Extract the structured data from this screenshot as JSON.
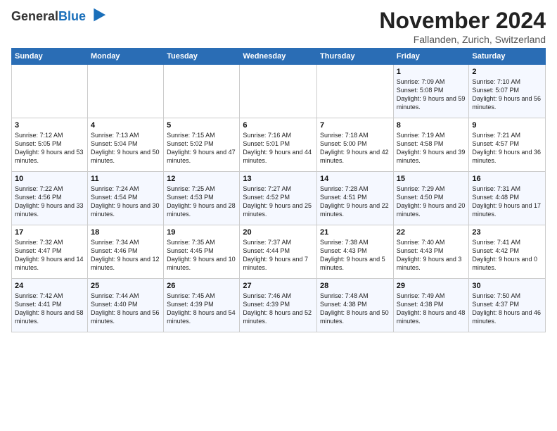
{
  "logo": {
    "text1": "General",
    "text2": "Blue"
  },
  "title": "November 2024",
  "subtitle": "Fallanden, Zurich, Switzerland",
  "days_of_week": [
    "Sunday",
    "Monday",
    "Tuesday",
    "Wednesday",
    "Thursday",
    "Friday",
    "Saturday"
  ],
  "weeks": [
    [
      {
        "day": "",
        "content": ""
      },
      {
        "day": "",
        "content": ""
      },
      {
        "day": "",
        "content": ""
      },
      {
        "day": "",
        "content": ""
      },
      {
        "day": "",
        "content": ""
      },
      {
        "day": "1",
        "content": "Sunrise: 7:09 AM\nSunset: 5:08 PM\nDaylight: 9 hours and 59 minutes."
      },
      {
        "day": "2",
        "content": "Sunrise: 7:10 AM\nSunset: 5:07 PM\nDaylight: 9 hours and 56 minutes."
      }
    ],
    [
      {
        "day": "3",
        "content": "Sunrise: 7:12 AM\nSunset: 5:05 PM\nDaylight: 9 hours and 53 minutes."
      },
      {
        "day": "4",
        "content": "Sunrise: 7:13 AM\nSunset: 5:04 PM\nDaylight: 9 hours and 50 minutes."
      },
      {
        "day": "5",
        "content": "Sunrise: 7:15 AM\nSunset: 5:02 PM\nDaylight: 9 hours and 47 minutes."
      },
      {
        "day": "6",
        "content": "Sunrise: 7:16 AM\nSunset: 5:01 PM\nDaylight: 9 hours and 44 minutes."
      },
      {
        "day": "7",
        "content": "Sunrise: 7:18 AM\nSunset: 5:00 PM\nDaylight: 9 hours and 42 minutes."
      },
      {
        "day": "8",
        "content": "Sunrise: 7:19 AM\nSunset: 4:58 PM\nDaylight: 9 hours and 39 minutes."
      },
      {
        "day": "9",
        "content": "Sunrise: 7:21 AM\nSunset: 4:57 PM\nDaylight: 9 hours and 36 minutes."
      }
    ],
    [
      {
        "day": "10",
        "content": "Sunrise: 7:22 AM\nSunset: 4:56 PM\nDaylight: 9 hours and 33 minutes."
      },
      {
        "day": "11",
        "content": "Sunrise: 7:24 AM\nSunset: 4:54 PM\nDaylight: 9 hours and 30 minutes."
      },
      {
        "day": "12",
        "content": "Sunrise: 7:25 AM\nSunset: 4:53 PM\nDaylight: 9 hours and 28 minutes."
      },
      {
        "day": "13",
        "content": "Sunrise: 7:27 AM\nSunset: 4:52 PM\nDaylight: 9 hours and 25 minutes."
      },
      {
        "day": "14",
        "content": "Sunrise: 7:28 AM\nSunset: 4:51 PM\nDaylight: 9 hours and 22 minutes."
      },
      {
        "day": "15",
        "content": "Sunrise: 7:29 AM\nSunset: 4:50 PM\nDaylight: 9 hours and 20 minutes."
      },
      {
        "day": "16",
        "content": "Sunrise: 7:31 AM\nSunset: 4:48 PM\nDaylight: 9 hours and 17 minutes."
      }
    ],
    [
      {
        "day": "17",
        "content": "Sunrise: 7:32 AM\nSunset: 4:47 PM\nDaylight: 9 hours and 14 minutes."
      },
      {
        "day": "18",
        "content": "Sunrise: 7:34 AM\nSunset: 4:46 PM\nDaylight: 9 hours and 12 minutes."
      },
      {
        "day": "19",
        "content": "Sunrise: 7:35 AM\nSunset: 4:45 PM\nDaylight: 9 hours and 10 minutes."
      },
      {
        "day": "20",
        "content": "Sunrise: 7:37 AM\nSunset: 4:44 PM\nDaylight: 9 hours and 7 minutes."
      },
      {
        "day": "21",
        "content": "Sunrise: 7:38 AM\nSunset: 4:43 PM\nDaylight: 9 hours and 5 minutes."
      },
      {
        "day": "22",
        "content": "Sunrise: 7:40 AM\nSunset: 4:43 PM\nDaylight: 9 hours and 3 minutes."
      },
      {
        "day": "23",
        "content": "Sunrise: 7:41 AM\nSunset: 4:42 PM\nDaylight: 9 hours and 0 minutes."
      }
    ],
    [
      {
        "day": "24",
        "content": "Sunrise: 7:42 AM\nSunset: 4:41 PM\nDaylight: 8 hours and 58 minutes."
      },
      {
        "day": "25",
        "content": "Sunrise: 7:44 AM\nSunset: 4:40 PM\nDaylight: 8 hours and 56 minutes."
      },
      {
        "day": "26",
        "content": "Sunrise: 7:45 AM\nSunset: 4:39 PM\nDaylight: 8 hours and 54 minutes."
      },
      {
        "day": "27",
        "content": "Sunrise: 7:46 AM\nSunset: 4:39 PM\nDaylight: 8 hours and 52 minutes."
      },
      {
        "day": "28",
        "content": "Sunrise: 7:48 AM\nSunset: 4:38 PM\nDaylight: 8 hours and 50 minutes."
      },
      {
        "day": "29",
        "content": "Sunrise: 7:49 AM\nSunset: 4:38 PM\nDaylight: 8 hours and 48 minutes."
      },
      {
        "day": "30",
        "content": "Sunrise: 7:50 AM\nSunset: 4:37 PM\nDaylight: 8 hours and 46 minutes."
      }
    ]
  ]
}
